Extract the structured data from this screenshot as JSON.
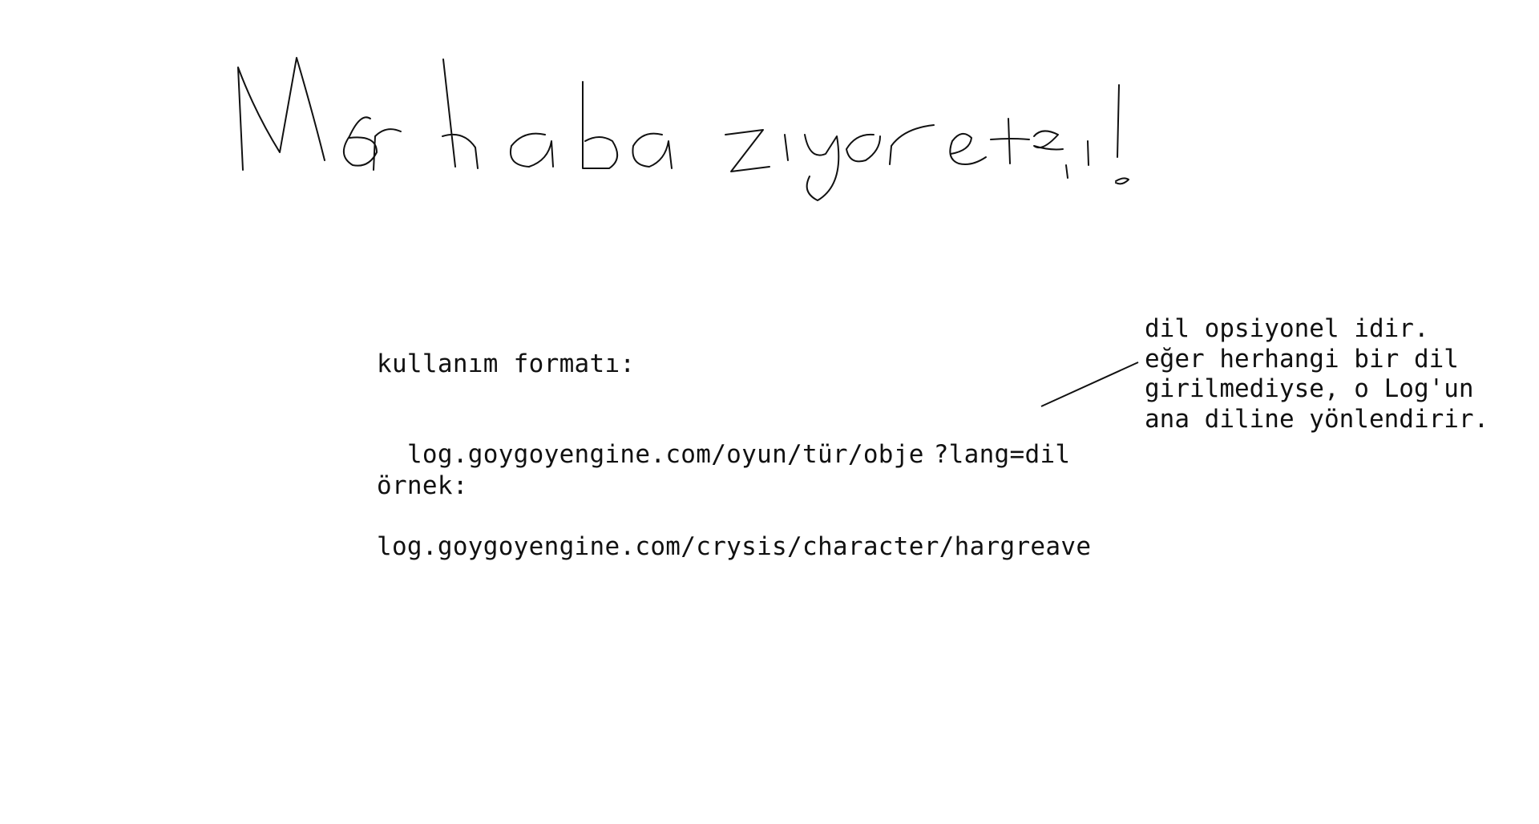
{
  "heading": {
    "text": "Merhaba ziyaretçi!"
  },
  "usage": {
    "format_label": "kullanım formatı:",
    "format_url": "log.goygoyengine.com/oyun/tür/obje",
    "format_query": "?lang=dil",
    "example_label": "örnek:",
    "example_url": "log.goygoyengine.com/crysis/character/hargreave"
  },
  "side_note": {
    "line1": "dil opsiyonel idir.",
    "line2": "eğer herhangi bir dil",
    "line3": "girilmediyse, o Log'un",
    "line4": "ana diline yönlendirir."
  }
}
